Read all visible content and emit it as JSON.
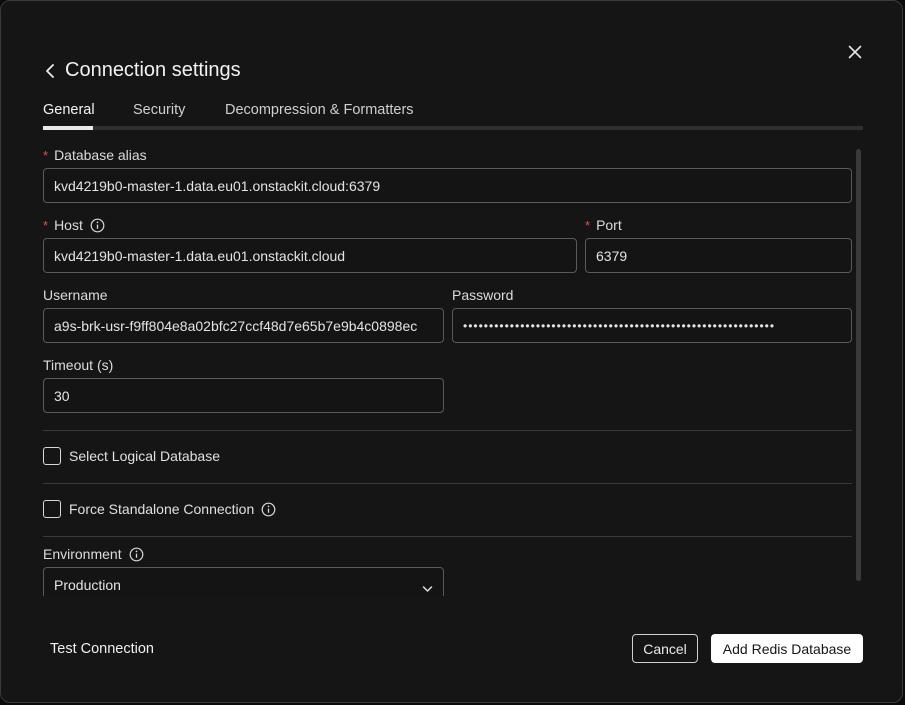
{
  "dialog": {
    "title": "Connection settings"
  },
  "tabs": [
    {
      "label": "General",
      "active": true
    },
    {
      "label": "Security",
      "active": false
    },
    {
      "label": "Decompression & Formatters",
      "active": false
    }
  ],
  "form": {
    "required_mark": "*",
    "database_alias": {
      "label": "Database alias",
      "value": "kvd4219b0-master-1.data.eu01.onstackit.cloud:6379"
    },
    "host": {
      "label": "Host",
      "value": "kvd4219b0-master-1.data.eu01.onstackit.cloud"
    },
    "port": {
      "label": "Port",
      "value": "6379"
    },
    "username": {
      "label": "Username",
      "value": "a9s-brk-usr-f9ff804e8a02bfc27ccf48d7e65b7e9b4c0898ec"
    },
    "password": {
      "label": "Password",
      "value": "••••••••••••••••••••••••••••••••••••••••••••••••••••••••••••"
    },
    "timeout": {
      "label": "Timeout (s)",
      "value": "30"
    },
    "select_logical_database": {
      "label": "Select Logical Database",
      "checked": false
    },
    "force_standalone": {
      "label": "Force Standalone Connection",
      "checked": false
    },
    "environment": {
      "label": "Environment",
      "value": "Production"
    }
  },
  "footer": {
    "test_connection": "Test Connection",
    "cancel": "Cancel",
    "add": "Add Redis Database"
  },
  "icons": {
    "close": "close-icon",
    "back": "chevron-left-icon",
    "info": "info-icon",
    "dropdown": "chevron-down-icon"
  },
  "colors": {
    "background": "#151515",
    "required": "#e0544a",
    "primary_button": "#ffffff"
  }
}
